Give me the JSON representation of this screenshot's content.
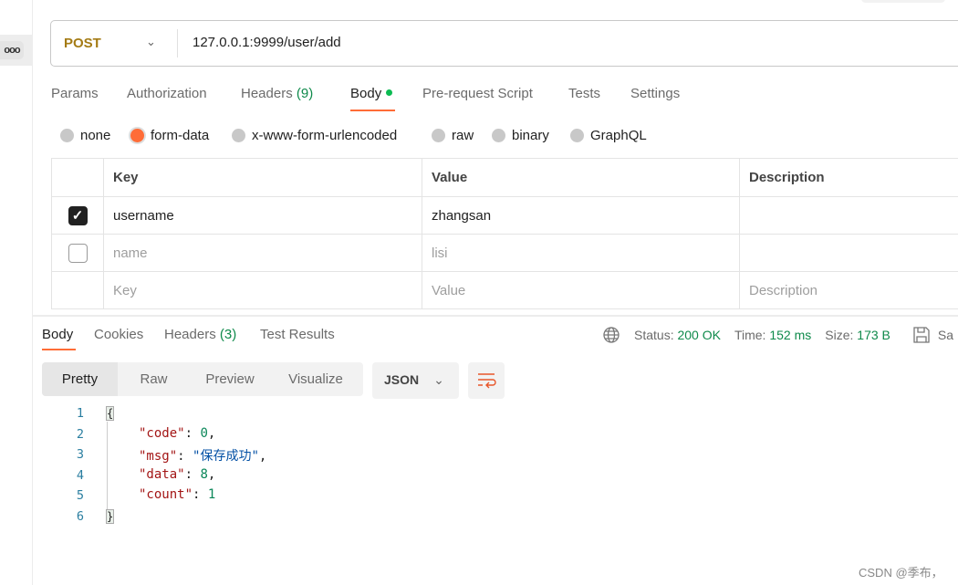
{
  "sidebar": {
    "more_label": "ooo"
  },
  "request": {
    "method": "POST",
    "url": "127.0.0.1:9999/user/add"
  },
  "request_tabs": [
    {
      "label": "Params"
    },
    {
      "label": "Authorization"
    },
    {
      "label": "Headers",
      "count": "(9)"
    },
    {
      "label": "Body",
      "active": true
    },
    {
      "label": "Pre-request Script"
    },
    {
      "label": "Tests"
    },
    {
      "label": "Settings"
    }
  ],
  "body_types": [
    {
      "label": "none"
    },
    {
      "label": "form-data",
      "selected": true
    },
    {
      "label": "x-www-form-urlencoded"
    },
    {
      "label": "raw"
    },
    {
      "label": "binary"
    },
    {
      "label": "GraphQL"
    }
  ],
  "table": {
    "headers": [
      "Key",
      "Value",
      "Description"
    ],
    "rows": [
      {
        "checked": true,
        "key": "username",
        "value": "zhangsan",
        "description": ""
      },
      {
        "checked": false,
        "key": "name",
        "value": "lisi",
        "description": ""
      }
    ],
    "placeholder": {
      "key": "Key",
      "value": "Value",
      "description": "Description"
    }
  },
  "response": {
    "tabs": [
      {
        "label": "Body",
        "active": true
      },
      {
        "label": "Cookies"
      },
      {
        "label": "Headers",
        "count": "(3)"
      },
      {
        "label": "Test Results"
      }
    ],
    "status_label": "Status:",
    "status": "200 OK",
    "time_label": "Time:",
    "time": "152 ms",
    "size_label": "Size:",
    "size": "173 B",
    "save_label": "Sa",
    "views": [
      "Pretty",
      "Raw",
      "Preview",
      "Visualize"
    ],
    "active_view": "Pretty",
    "format": "JSON",
    "lines": [
      "1",
      "2",
      "3",
      "4",
      "5",
      "6"
    ],
    "json": {
      "open": "{",
      "code_key": "\"code\"",
      "code_val": "0",
      "msg_key": "\"msg\"",
      "msg_val": "\"保存成功\"",
      "data_key": "\"data\"",
      "data_val": "8",
      "count_key": "\"count\"",
      "count_val": "1",
      "close": "}"
    }
  },
  "colors": {
    "accent": "#ff6c37",
    "method": "#a47b14",
    "success": "#0f8a4b"
  },
  "watermark": "CSDN @季布，"
}
